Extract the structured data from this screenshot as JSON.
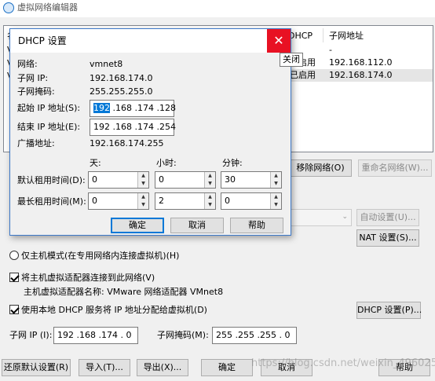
{
  "main": {
    "title": "虚拟网络编辑器",
    "table": {
      "col_dhcp": "DHCP",
      "col_subnet": "子网地址",
      "rows": [
        {
          "dhcp": "",
          "subnet": "-"
        },
        {
          "dhcp": "已启用",
          "subnet": "192.168.112.0"
        },
        {
          "dhcp": "已启用",
          "subnet": "192.168.174.0"
        }
      ],
      "left_letters": [
        "名",
        "V",
        "V",
        "V"
      ]
    },
    "remove_network_btn": "移除网络(O)",
    "rename_network_btn": "重命名网络(W)...",
    "auto_settings_btn": "自动设置(U)...",
    "nat_settings_btn": "NAT 设置(S)...",
    "host_only_radio": "仅主机模式(在专用网络内连接虚拟机)(H)",
    "connect_host_adapter_check": "将主机虚拟适配器连接到此网络(V)",
    "host_adapter_name": "主机虚拟适配器名称: VMware 网络适配器 VMnet8",
    "use_dhcp_check": "使用本地 DHCP 服务将 IP 地址分配给虚拟机(D)",
    "dhcp_settings_btn": "DHCP 设置(P)...",
    "subnet_ip_label": "子网 IP (I):",
    "subnet_ip_value": "192 .168 .174 . 0",
    "subnet_mask_label": "子网掩码(M):",
    "subnet_mask_value": "255 .255 .255 . 0",
    "restore_defaults_btn": "还原默认设置(R)",
    "import_btn": "导入(T)...",
    "export_btn": "导出(X)...",
    "ok_btn": "确定",
    "cancel_btn": "取消",
    "help_btn": "帮助",
    "watermark": "https://blog.csdn.net/weixin_49602585"
  },
  "dialog": {
    "title": "DHCP 设置",
    "close_tooltip": "关闭",
    "network_label": "网络:",
    "network_value": "vmnet8",
    "subnet_ip_label": "子网 IP:",
    "subnet_ip_value": "192.168.174.0",
    "subnet_mask_label": "子网掩码:",
    "subnet_mask_value": "255.255.255.0",
    "start_ip_label": "起始 IP 地址(S):",
    "start_ip_sel": "192",
    "start_ip_rest": " .168 .174 .128",
    "end_ip_label": "结束 IP 地址(E):",
    "end_ip_value": "192 .168 .174 .254",
    "broadcast_label": "广播地址:",
    "broadcast_value": "192.168.174.255",
    "days_label": "天:",
    "hours_label": "小时:",
    "minutes_label": "分钟:",
    "default_lease_label": "默认租用时间(D):",
    "default_lease": {
      "days": "0",
      "hours": "0",
      "minutes": "30"
    },
    "max_lease_label": "最长租用时间(M):",
    "max_lease": {
      "days": "0",
      "hours": "2",
      "minutes": "0"
    },
    "ok_btn": "确定",
    "cancel_btn": "取消",
    "help_btn": "帮助"
  }
}
